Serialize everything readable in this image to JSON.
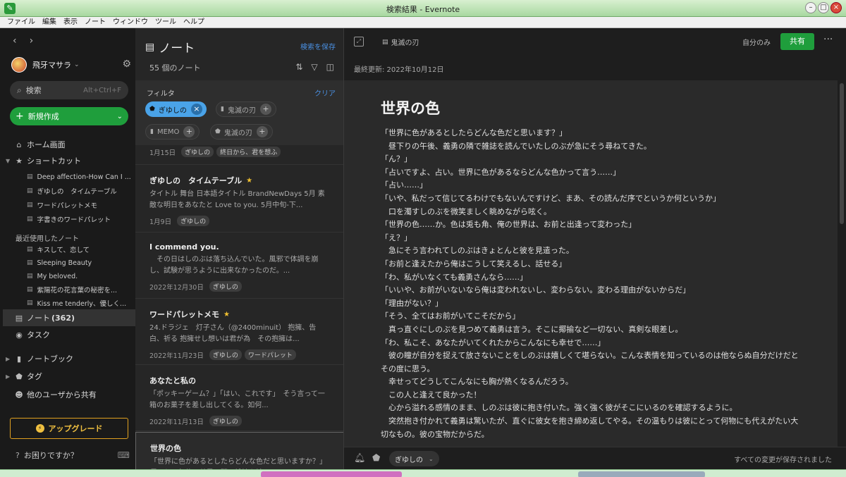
{
  "window": {
    "title": "検索結果 - Evernote"
  },
  "menu": [
    "ファイル",
    "編集",
    "表示",
    "ノート",
    "ウィンドウ",
    "ツール",
    "ヘルプ"
  ],
  "sidebar": {
    "user_name": "飛牙マサラ",
    "search_label": "検索",
    "search_shortcut": "Alt+Ctrl+F",
    "new_label": "新規作成",
    "home": "ホーム画面",
    "shortcuts_label": "ショートカット",
    "shortcuts": [
      "Deep affection-How Can I ...",
      "ぎゆしの　タイムテーブル",
      "ワードパレットメモ",
      "字書きのワードパレット"
    ],
    "recent_label": "最近使用したノート",
    "recent": [
      "キスして、恋して",
      "Sleeping Beauty",
      "My beloved.",
      "紫陽花の花言葉の秘密を...",
      "Kiss me tenderly、優しく..."
    ],
    "notes_label": "ノート",
    "notes_count": "(362)",
    "tasks_label": "タスク",
    "notebooks_label": "ノートブック",
    "tags_label": "タグ",
    "shared_label": "他のユーザから共有",
    "upgrade_label": "アップグレード",
    "help_label": "お困りですか？"
  },
  "notelist": {
    "title": "ノート",
    "save_search": "検索を保存",
    "count": "55 個のノート",
    "filter_label": "フィルタ",
    "clear_label": "クリア",
    "chips": [
      {
        "label": "ぎゆしの",
        "selected": true
      },
      {
        "label": "鬼滅の刃",
        "selected": false
      },
      {
        "label": "MEMO",
        "selected": false
      },
      {
        "label": "鬼滅の刃",
        "selected": false
      }
    ],
    "notes": [
      {
        "title": "",
        "snippet": "",
        "date": "1月15日",
        "tags": [
          "ぎゆしの",
          "終日から、君を想ふ"
        ],
        "star": false
      },
      {
        "title": "ぎゆしの　タイムテーブル",
        "snippet": "タイトル 舞台 日本語タイトル BrandNewDays 5月 素敵な明日をあなたと Love to you. 5月中旬-下...",
        "date": "1月9日",
        "tags": [
          "ぎゆしの"
        ],
        "star": true
      },
      {
        "title": "I commend you.",
        "snippet": "　その日はしのぶは落ち込んでいた。風邪で体調を崩し、試験が思うように出来なかったのだ。...",
        "date": "2022年12月30日",
        "tags": [
          "ぎゆしの"
        ],
        "star": false
      },
      {
        "title": "ワードパレットメモ",
        "snippet": "24.ドラジェ　灯子さん（@2400minuit） 抱擁、告白、祈る 抱擁せし想いは君が為　その抱擁は...",
        "date": "2022年11月23日",
        "tags": [
          "ぎゆしの",
          "ワードパレット"
        ],
        "star": true
      },
      {
        "title": "あなたと私の",
        "snippet": "「ポッキーゲーム？」「はい、これです」　そう言って一箱のお菓子を差し出してくる。如何...",
        "date": "2022年11月13日",
        "tags": [
          "ぎゆしの"
        ],
        "star": false
      },
      {
        "title": "世界の色",
        "snippet": "「世界に色があるとしたらどんな色だと思いますか？」　昼下りの午後、義勇の隣で雑誌を読ん...",
        "date": "",
        "tags": [],
        "star": false
      }
    ]
  },
  "editor": {
    "notebook": "鬼滅の刃",
    "private_label": "自分のみ",
    "share_label": "共有",
    "last_updated": "最終更新: 2022年10月12日",
    "title": "世界の色",
    "paragraphs": [
      "「世界に色があるとしたらどんな色だと思います？」",
      "　昼下りの午後、義勇の隣で雑誌を読んでいたしのぶが急にそう尋ねてきた。",
      "「ん？」",
      "「占いですよ、占い。世界に色があるならどんな色かって言う……」",
      "「占い……」",
      "「いや、私だって信じてるわけでもないんですけど、まあ、その読んだ序でというか何というか」",
      "　口を濁すしのぶを微笑ましく眺めながら呟く。",
      "「世界の色……か。色は兎も角、俺の世界は、お前と出逢って変わった」",
      "「え？」",
      "　急にそう言われてしのぶはきょとんと彼を見遣った。",
      "「お前と逢えたから俺はこうして笑えるし、話せる」",
      "「わ、私がいなくても義勇さんなら……」",
      "「いいや、お前がいないなら俺は変われないし、変わらない。変わる理由がないからだ」",
      "「理由がない？」",
      "「そう、全てはお前がいてこそだから」",
      "　真っ直ぐにしのぶを見つめて義勇は言う。そこに揶揄など一切ない、真剣な眼差し。",
      "「わ、私こそ、あなたがいてくれたからこんなにも幸せで……」",
      "　彼の瞳が自分を捉えて放さないことをしのぶは嬉しくて堪らない。こんな表情を知っているのは他ならぬ自分だけだとその度に思う。",
      "　幸せってどうしてこんなにも胸が熱くなるんだろう。",
      "　この人と逢えて良かった！",
      "　心から溢れる感情のまま、しのぶは彼に抱き付いた。強く強く彼がそこにいるのを確認するように。",
      "　突然抱き付かれて義勇は驚いたが、直ぐに彼女を抱き締め返してやる。その温もりは彼にとって何物にも代えがたい大切なもの。彼の宝物だからだ。"
    ],
    "bottom_tag": "ぎゆしの",
    "saved_status": "すべての変更が保存されました"
  }
}
